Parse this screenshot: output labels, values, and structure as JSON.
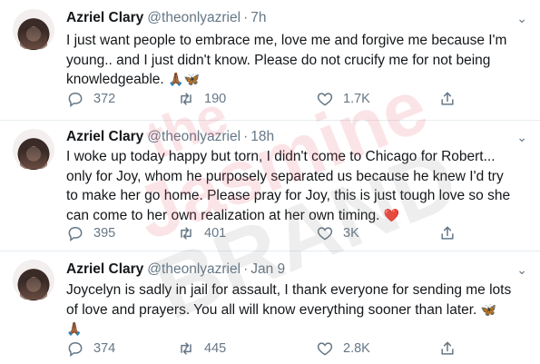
{
  "tweets": [
    {
      "name": "Azriel Clary",
      "handle": "@theonlyazriel",
      "sep": "·",
      "time": "7h",
      "lines": [
        "I just want people to embrace me, love me and forgive me because I'm",
        "young.. and I just didn't know. Please do not crucify me for not being",
        "knowledgeable."
      ],
      "emoji": [
        "🙏🏾",
        "🦋"
      ],
      "replies": "372",
      "retweets": "190",
      "likes": "1.7K"
    },
    {
      "name": "Azriel Clary",
      "handle": "@theonlyazriel",
      "sep": "·",
      "time": "18h",
      "lines": [
        "I woke up today happy but torn, I didn't come to Chicago for Robert...",
        "only for Joy, whom he purposely separated us because he knew I'd try",
        "to make her go home. Please pray for Joy, this is just tough love so she",
        "can come to her own realization at her own timing."
      ],
      "emoji": [
        "❤️"
      ],
      "replies": "395",
      "retweets": "401",
      "likes": "3K"
    },
    {
      "name": "Azriel Clary",
      "handle": "@theonlyazriel",
      "sep": "·",
      "time": "Jan 9",
      "lines": [
        "Joycelyn is sadly in jail for assault, I thank everyone for sending me lots",
        "of love and prayers. You all will know everything sooner than later."
      ],
      "emoji": [
        "🦋",
        "🙏🏾"
      ],
      "replies": "374",
      "retweets": "445",
      "likes": "2.8K"
    }
  ],
  "watermark": [
    "the",
    "Jasmine",
    "BRAND"
  ],
  "colors": {
    "text": "#14171a",
    "muted": "#657786",
    "divider": "#e6ecf0",
    "heart": "#e0245e"
  }
}
